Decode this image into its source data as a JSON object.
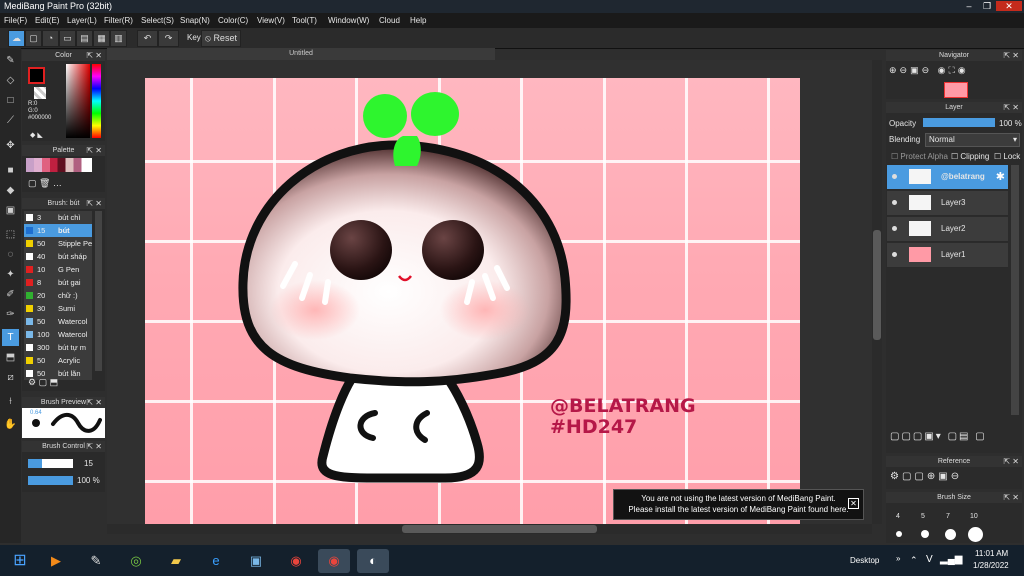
{
  "window": {
    "title": "MediBang Paint Pro (32bit)"
  },
  "menu": [
    "File(F)",
    "Edit(E)",
    "Layer(L)",
    "Filter(R)",
    "Select(S)",
    "Snap(N)",
    "Color(C)",
    "View(V)",
    "Tool(T)",
    "Window(W)",
    "Cloud",
    "Help"
  ],
  "toolbar": {
    "key_label": "Key",
    "reset_label": "Reset"
  },
  "document": {
    "tab_title": "Untitled"
  },
  "color_panel": {
    "title": "Color",
    "r": "R:0",
    "g": "G:0",
    "hex": "#000000"
  },
  "palette_panel": {
    "title": "Palette"
  },
  "brush_panel": {
    "title": "Brush: bút",
    "brushes": [
      {
        "size": "3",
        "name": "bút chì",
        "color": "#ffffff"
      },
      {
        "size": "15",
        "name": "bút",
        "color": "#1e6fd0",
        "selected": true
      },
      {
        "size": "50",
        "name": "Stipple Pe",
        "color": "#f0d000"
      },
      {
        "size": "40",
        "name": "bút sháp",
        "color": "#ffffff"
      },
      {
        "size": "10",
        "name": "G Pen",
        "color": "#e02020"
      },
      {
        "size": "8",
        "name": "bút gai",
        "color": "#e02020"
      },
      {
        "size": "20",
        "name": "chữ :)",
        "color": "#30b030"
      },
      {
        "size": "30",
        "name": "Sumi",
        "color": "#f0d000"
      },
      {
        "size": "50",
        "name": "Watercol",
        "color": "#7ab8e8"
      },
      {
        "size": "100",
        "name": "Watercol",
        "color": "#7ab8e8"
      },
      {
        "size": "300",
        "name": "bút tự m",
        "color": "#ffffff"
      },
      {
        "size": "50",
        "name": "Acrylic",
        "color": "#f0d000"
      },
      {
        "size": "50",
        "name": "bút lăn",
        "color": "#ffffff"
      }
    ]
  },
  "brush_preview": {
    "title": "Brush Preview",
    "size_label": "0.64"
  },
  "brush_control": {
    "title": "Brush Control",
    "size": "15",
    "opacity": "100 %",
    "opacity_level": 1.0
  },
  "navigator": {
    "title": "Navigator"
  },
  "layer_panel": {
    "title": "Layer",
    "opacity_label": "Opacity",
    "opacity_value": "100 %",
    "opacity_level": 1.0,
    "blending_label": "Blending",
    "blending_value": "Normal",
    "protect_alpha": "Protect Alpha",
    "clipping": "Clipping",
    "lock": "Lock",
    "layers": [
      {
        "name": "@belatrang",
        "selected": true
      },
      {
        "name": "Layer3"
      },
      {
        "name": "Layer2"
      },
      {
        "name": "Layer1"
      }
    ]
  },
  "reference": {
    "title": "Reference"
  },
  "brush_size": {
    "title": "Brush Size",
    "sizes": [
      "4",
      "5",
      "7",
      "10"
    ]
  },
  "artwork": {
    "line1": "@BELATRANG",
    "line2": "#HD247"
  },
  "notification": {
    "line1": "You are not using the latest version of MediBang Paint.",
    "line2": "Please install the latest version of MediBang Paint found here."
  },
  "taskbar": {
    "desktop_label": "Desktop",
    "time": "11:01 AM",
    "date": "1/28/2022",
    "lang": "V"
  },
  "colors": {
    "canvas_pink": "#ffb0ba",
    "sprout_green": "#2ef52e",
    "text_crimson": "#b51848",
    "accent_blue": "#4a9be0"
  }
}
